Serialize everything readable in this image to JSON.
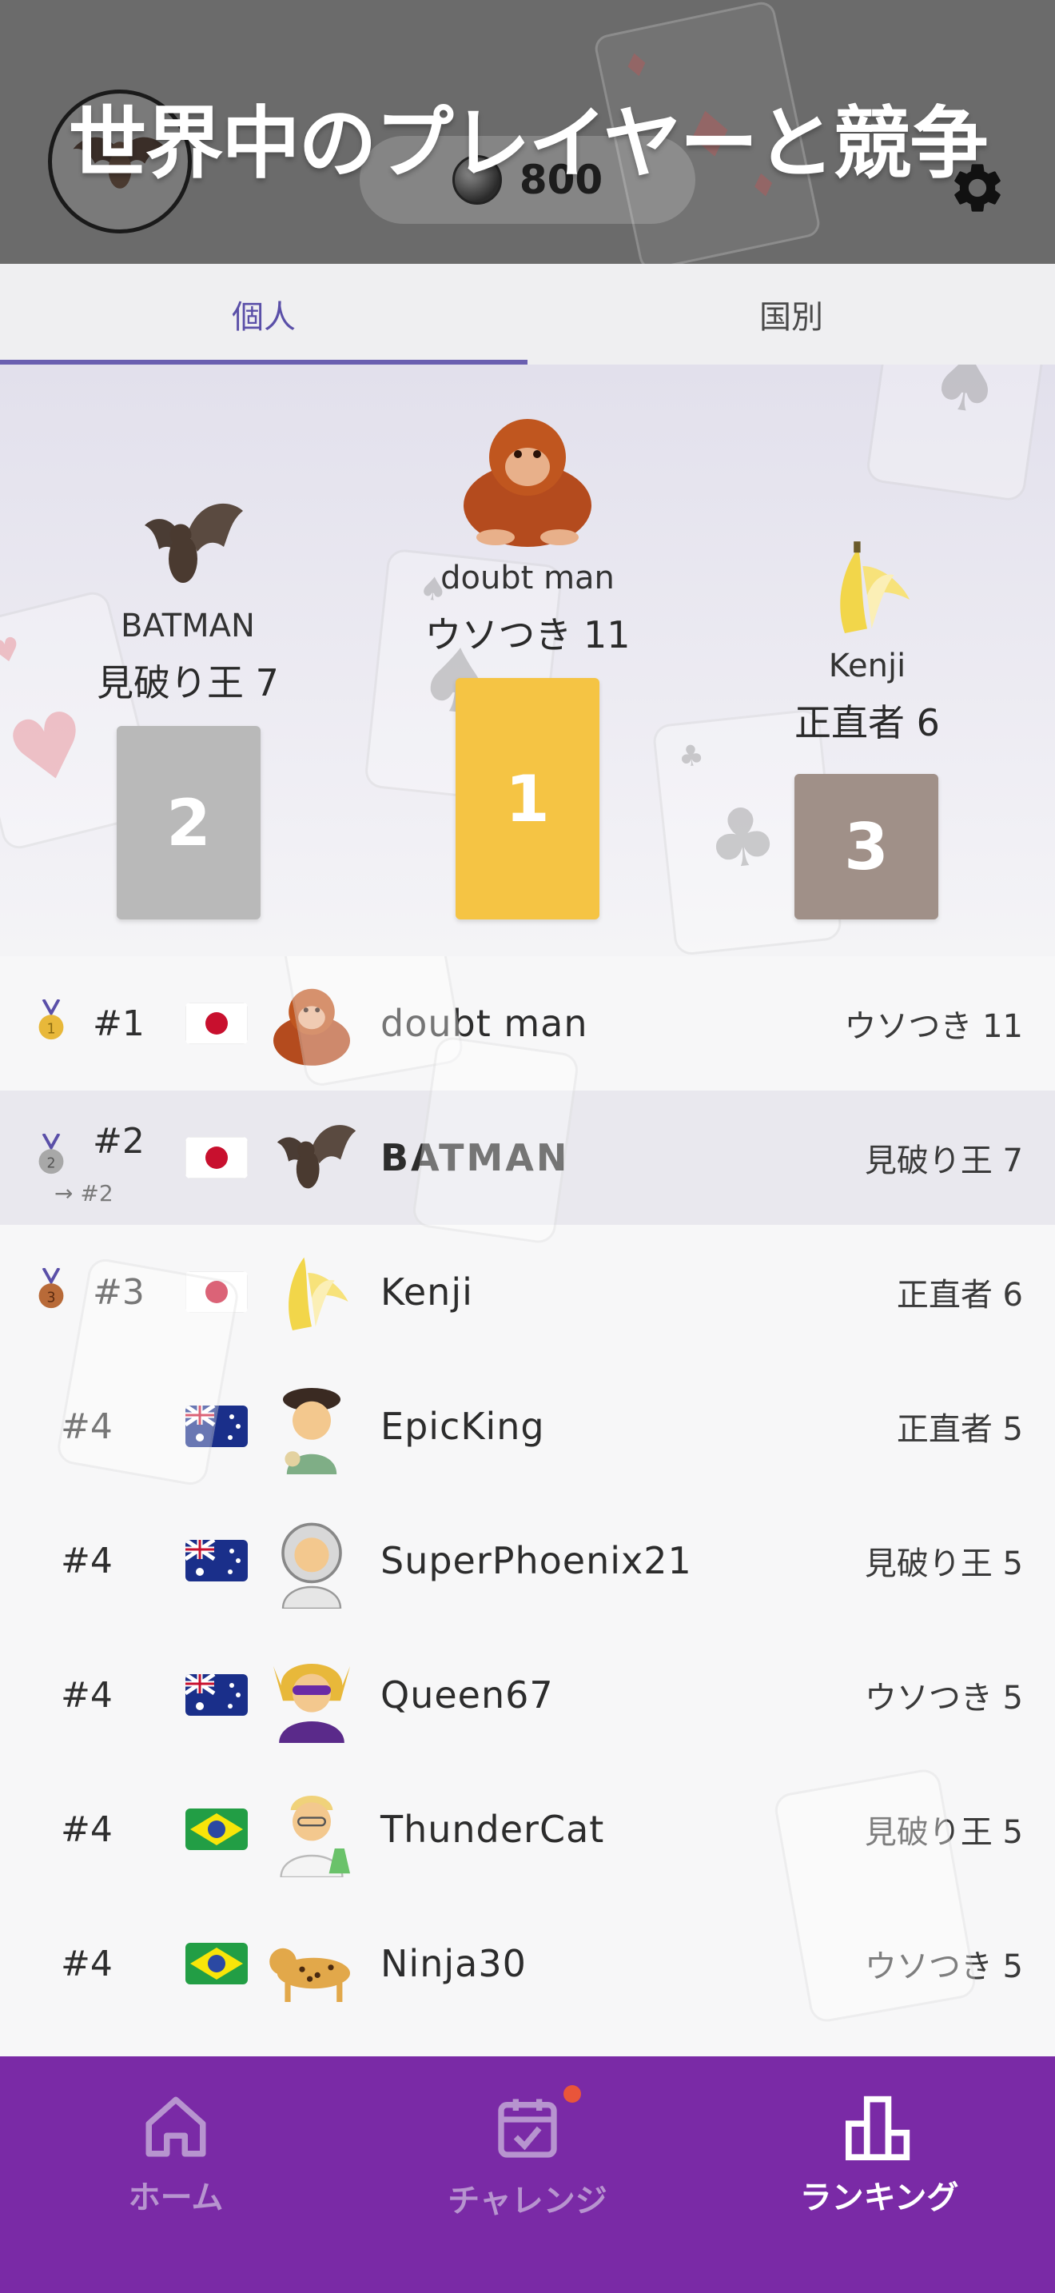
{
  "header": {
    "headline": "世界中のプレイヤーと競争",
    "coins": "800",
    "avatar_icon": "bat-avatar",
    "settings_icon": "gear-icon"
  },
  "tabs": [
    {
      "label": "個人",
      "active": true
    },
    {
      "label": "国別",
      "active": false
    }
  ],
  "podium": {
    "first": {
      "name": "doubt man",
      "score": "ウソつき 11",
      "place": "1",
      "color": "#f5c444"
    },
    "second": {
      "name": "BATMAN",
      "score": "見破り王 7",
      "place": "2",
      "color": "#b9b9b9"
    },
    "third": {
      "name": "Kenji",
      "score": "正直者 6",
      "place": "3",
      "color": "#a09088"
    }
  },
  "leaderboard": [
    {
      "rank": "#1",
      "medal": "gold",
      "flag": "japan",
      "avatar": "orangutan",
      "name": "doubt man",
      "score": "ウソつき 11"
    },
    {
      "rank": "#2",
      "sub_rank": "→ #2",
      "medal": "silver",
      "flag": "japan",
      "avatar": "bat",
      "name": "BATMAN",
      "score": "見破り王 7",
      "current_user": true
    },
    {
      "rank": "#3",
      "medal": "bronze",
      "flag": "japan",
      "avatar": "banana",
      "name": "Kenji",
      "score": "正直者 6"
    },
    {
      "rank": "#4",
      "flag": "australia",
      "avatar": "artist",
      "name": "EpicKing",
      "score": "正直者 5"
    },
    {
      "rank": "#4",
      "flag": "australia",
      "avatar": "astronaut",
      "name": "SuperPhoenix21",
      "score": "見破り王 5"
    },
    {
      "rank": "#4",
      "flag": "australia",
      "avatar": "supervillain",
      "name": "Queen67",
      "score": "ウソつき 5"
    },
    {
      "rank": "#4",
      "flag": "brazil",
      "avatar": "scientist",
      "name": "ThunderCat",
      "score": "見破り王 5"
    },
    {
      "rank": "#4",
      "flag": "brazil",
      "avatar": "leopard",
      "name": "Ninja30",
      "score": "ウソつき 5"
    }
  ],
  "nav": [
    {
      "label": "ホーム",
      "icon": "home-icon",
      "active": false
    },
    {
      "label": "チャレンジ",
      "icon": "calendar-check-icon",
      "active": false,
      "badge": true
    },
    {
      "label": "ランキング",
      "icon": "ranking-bars-icon",
      "active": true
    }
  ]
}
